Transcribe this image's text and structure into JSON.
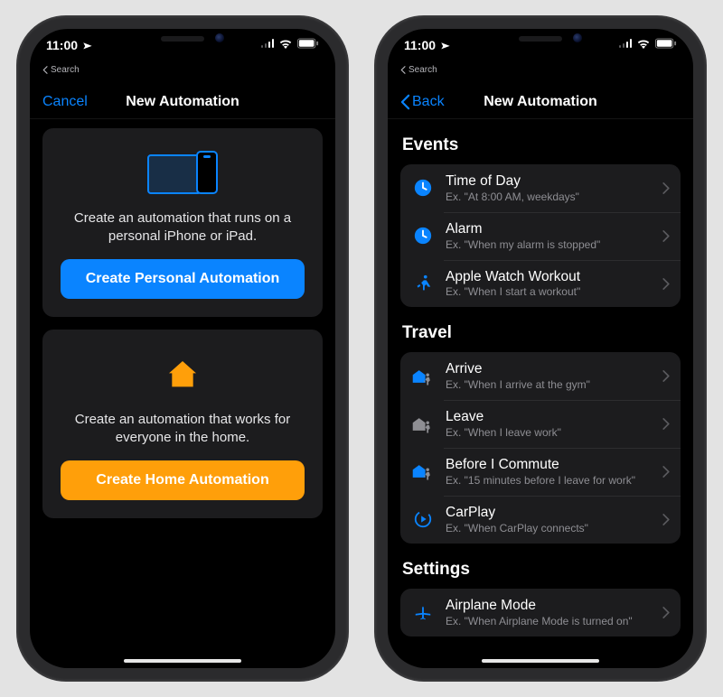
{
  "status": {
    "time": "11:00",
    "back_to_app": "Search"
  },
  "left_phone": {
    "nav": {
      "cancel": "Cancel",
      "title": "New Automation"
    },
    "card_personal": {
      "desc": "Create an automation that runs on a personal iPhone or iPad.",
      "button": "Create Personal Automation"
    },
    "card_home": {
      "desc": "Create an automation that works for everyone in the home.",
      "button": "Create Home Automation"
    }
  },
  "right_phone": {
    "nav": {
      "back": "Back",
      "title": "New Automation"
    },
    "sections": {
      "events": {
        "title": "Events",
        "items": [
          {
            "icon": "clock",
            "title": "Time of Day",
            "sub": "Ex. \"At 8:00 AM, weekdays\""
          },
          {
            "icon": "clock",
            "title": "Alarm",
            "sub": "Ex. \"When my alarm is stopped\""
          },
          {
            "icon": "runner",
            "title": "Apple Watch Workout",
            "sub": "Ex. \"When I start a workout\""
          }
        ]
      },
      "travel": {
        "title": "Travel",
        "items": [
          {
            "icon": "arrive",
            "title": "Arrive",
            "sub": "Ex. \"When I arrive at the gym\""
          },
          {
            "icon": "leave",
            "title": "Leave",
            "sub": "Ex. \"When I leave work\""
          },
          {
            "icon": "arrive",
            "title": "Before I Commute",
            "sub": "Ex. \"15 minutes before I leave for work\""
          },
          {
            "icon": "carplay",
            "title": "CarPlay",
            "sub": "Ex. \"When CarPlay connects\""
          }
        ]
      },
      "settings": {
        "title": "Settings",
        "items": [
          {
            "icon": "airplane",
            "title": "Airplane Mode",
            "sub": "Ex. \"When Airplane Mode is turned on\""
          }
        ]
      }
    }
  }
}
